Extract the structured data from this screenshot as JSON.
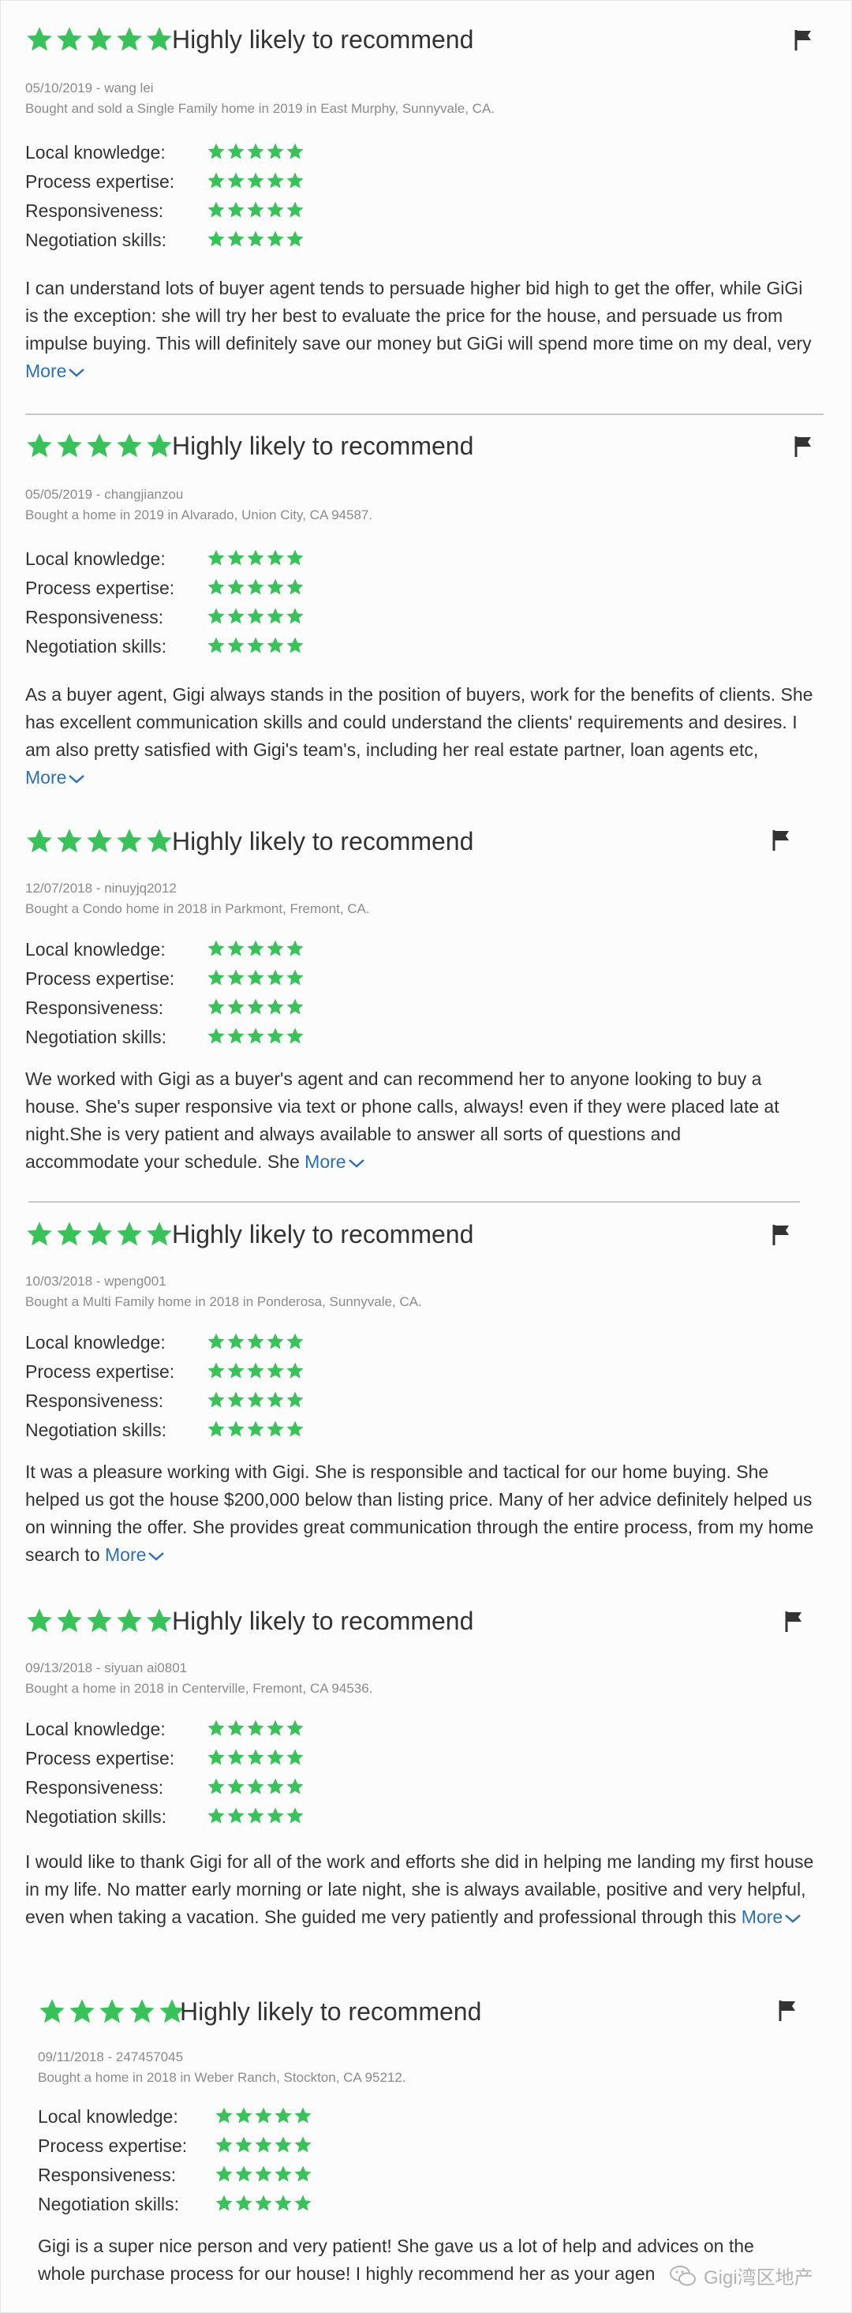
{
  "colors": {
    "star": "#3ac25a",
    "link": "#2d6fb5",
    "divider": "#c8c8c8"
  },
  "labels": {
    "local": "Local knowledge:",
    "process": "Process expertise:",
    "responsive": "Responsiveness:",
    "negotiation": "Negotiation skills:",
    "more": "More"
  },
  "reviews": [
    {
      "headline": "Highly likely to recommend",
      "date_author": "05/10/2019 - wang lei",
      "transaction": "Bought and sold a Single Family home in 2019 in East Murphy, Sunnyvale, CA.",
      "text": "I can understand lots of buyer agent tends to persuade higher bid high to get the offer, while GiGi is the exception: she will try her best to evaluate the price for the house, and persuade us from impulse buying. This will definitely save our money but GiGi will spend more time on my deal, very",
      "overall_rating": 5,
      "sub_ratings": [
        5,
        5,
        5,
        5
      ]
    },
    {
      "headline": "Highly likely to recommend",
      "date_author": "05/05/2019 - changjianzou",
      "transaction": "Bought a home in 2019 in Alvarado, Union City, CA 94587.",
      "text": "As a buyer agent, Gigi always stands in the position of buyers,  work for the benefits of clients.  She has excellent communication skills and could understand the clients' requirements and desires.  I am also pretty satisfied with Gigi's team's,  including her real estate partner, loan agents etc,",
      "overall_rating": 5,
      "sub_ratings": [
        5,
        5,
        5,
        5
      ]
    },
    {
      "headline": "Highly likely to recommend",
      "date_author": "12/07/2018 - ninuyjq2012",
      "transaction": "Bought a Condo home in 2018 in Parkmont, Fremont, CA.",
      "text": "We worked with Gigi as a buyer's agent and can recommend her to anyone looking to buy a house. She's super responsive via text or phone calls, always! even if they were placed late at night.She is very patient and always available to answer all sorts of questions and accommodate your schedule. She",
      "overall_rating": 5,
      "sub_ratings": [
        5,
        5,
        5,
        5
      ]
    },
    {
      "headline": "Highly likely to recommend",
      "date_author": "10/03/2018 - wpeng001",
      "transaction": "Bought a Multi Family home in 2018 in Ponderosa, Sunnyvale, CA.",
      "text": "It was a pleasure working with Gigi. She is responsible and tactical for our home buying. She helped us got the house $200,000 below than listing price. Many of her advice definitely helped us on winning the offer. She provides great communication through the entire process, from my home search to",
      "overall_rating": 5,
      "sub_ratings": [
        5,
        5,
        5,
        5
      ]
    },
    {
      "headline": "Highly likely to recommend",
      "date_author": "09/13/2018 - siyuan ai0801",
      "transaction": "Bought a home in 2018 in Centerville, Fremont, CA 94536.",
      "text": "I would like to thank Gigi for all of the work and efforts she did in helping me landing my first house in my life. No matter early morning or late night, she is always available, positive and very helpful, even when taking a vacation. She guided me very patiently and professional through this",
      "overall_rating": 5,
      "sub_ratings": [
        5,
        5,
        5,
        5
      ]
    },
    {
      "headline": "Highly likely to recommend",
      "date_author": "09/11/2018 - 247457045",
      "transaction": "Bought a home in 2018 in Weber Ranch, Stockton, CA 95212.",
      "text": "Gigi is a super nice person and very patient! She gave us a lot of help and advices on the whole purchase process for our house! I highly recommend her as your agen",
      "overall_rating": 5,
      "sub_ratings": [
        5,
        5,
        5,
        5
      ]
    }
  ],
  "watermark": "Gigi湾区地产"
}
